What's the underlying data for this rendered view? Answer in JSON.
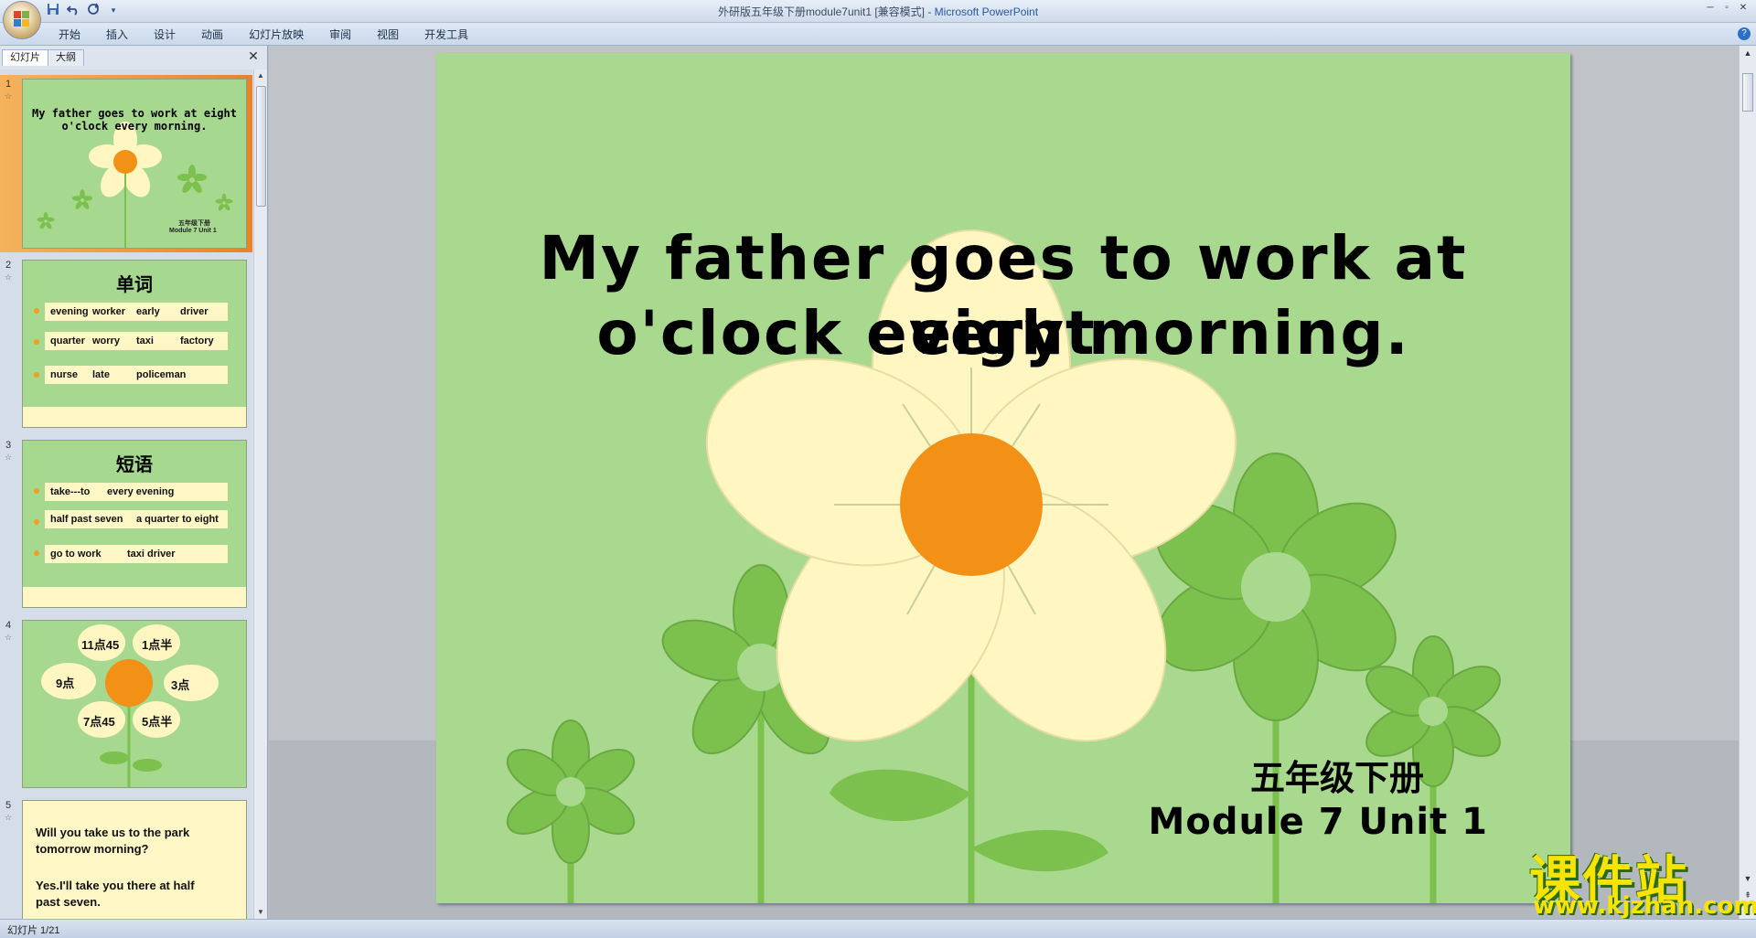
{
  "window": {
    "title_doc": "外研版五年级下册module7unit1 [兼容模式] - ",
    "title_app": "Microsoft PowerPoint"
  },
  "quick_access": {
    "save_icon": "save-icon",
    "undo_icon": "undo-icon",
    "redo_icon": "redo-icon",
    "customize_icon": "dropdown-icon"
  },
  "ribbon": {
    "tabs": [
      "开始",
      "插入",
      "设计",
      "动画",
      "幻灯片放映",
      "审阅",
      "视图",
      "开发工具"
    ],
    "help_label": "?"
  },
  "left_pane": {
    "tabs": [
      "幻灯片",
      "大纲"
    ],
    "close_label": "✕",
    "slides": [
      {
        "num": "1",
        "title": "My father goes to work at eight o'clock every morning.",
        "line1": "My father goes to work at eight",
        "line2": "o'clock every morning.",
        "grade": "五年级下册",
        "module": "Module 7 Unit 1"
      },
      {
        "num": "2",
        "title": "单词",
        "rows": [
          [
            "evening",
            "worker",
            "early",
            "driver"
          ],
          [
            "quarter",
            "worry",
            "taxi",
            "factory"
          ],
          [
            "nurse",
            "late",
            "policeman"
          ]
        ]
      },
      {
        "num": "3",
        "title": "短语",
        "rows": [
          [
            "take---to",
            "every evening"
          ],
          [
            "half past seven",
            "a quarter to eight"
          ],
          [
            "go to work",
            "taxi driver"
          ]
        ]
      },
      {
        "num": "4",
        "times": [
          "11点45",
          "1点半",
          "9点",
          "3点",
          "7点45",
          "5点半"
        ]
      },
      {
        "num": "5",
        "line1": "Will you take us to the park",
        "line2": "tomorrow morning?",
        "line3": "Yes.I'll take you there at half",
        "line4": "past seven."
      }
    ]
  },
  "slide": {
    "title_line1": "My father goes to work at eight",
    "title_line2": "o'clock every morning.",
    "grade": "五年级下册",
    "module": "Module 7 Unit 1",
    "colors": {
      "background": "#a8d98e",
      "petal": "#fff6c2",
      "center": "#f39016",
      "leaf": "#7cc04e",
      "stem": "#7cc04e"
    }
  },
  "status_bar": {
    "slide_info": "幻灯片 1/21"
  },
  "watermark": {
    "big": "课件站",
    "url": "www.kjzhan.com"
  }
}
